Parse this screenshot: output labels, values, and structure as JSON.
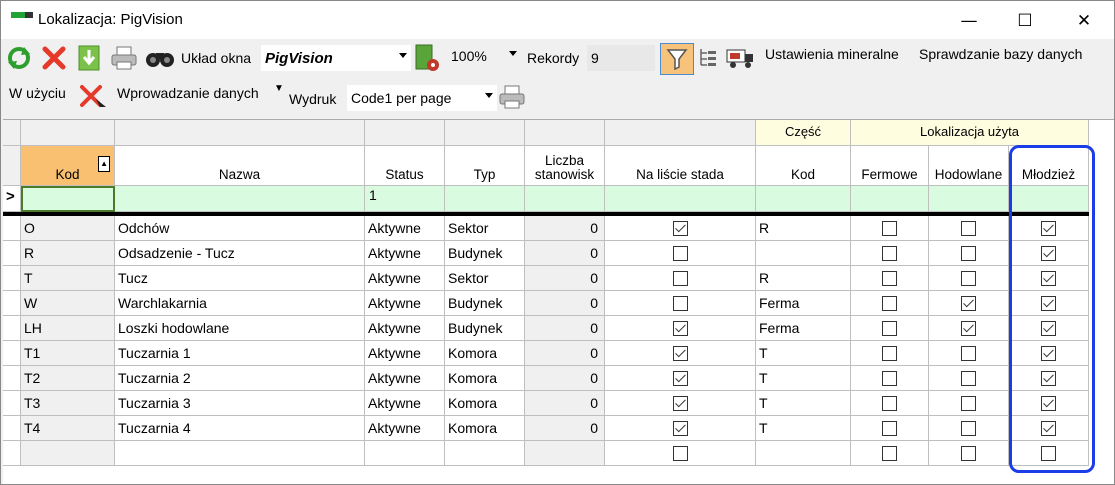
{
  "window": {
    "title": "Lokalizacja: PigVision",
    "min": "—",
    "max": "☐",
    "close": "✕"
  },
  "toolbar": {
    "uklad_label": "Układ okna",
    "uklad_value": "PigVision",
    "zoom": "100%",
    "rekordy_label": "Rekordy",
    "rekordy_value": "9",
    "ustawienia": "Ustawienia mineralne",
    "sprawdzanie": "Sprawdzanie bazy danych",
    "w_uzyciu": "W użyciu",
    "wprowadzanie": "Wprowadzanie danych",
    "wydruk_label": "Wydruk",
    "wydruk_value": "Code1 per page"
  },
  "grid": {
    "group_czesc": "Część",
    "group_lokalizacja": "Lokalizacja użyta",
    "headers": [
      "Kod",
      "Nazwa",
      "Status",
      "Typ",
      "Liczba stanowisk",
      "Na liście stada",
      "Kod",
      "Fermowe",
      "Hodowlane",
      "Młodzież"
    ],
    "new_row_status": "1",
    "rows": [
      {
        "kod": "O",
        "nazwa": "Odchów",
        "status": "Aktywne",
        "typ": "Sektor",
        "liczba": "0",
        "lista": true,
        "czesc": "R",
        "ferm": false,
        "hod": false,
        "mlo": true
      },
      {
        "kod": "R",
        "nazwa": "Odsadzenie - Tucz",
        "status": "Aktywne",
        "typ": "Budynek",
        "liczba": "0",
        "lista": false,
        "czesc": "",
        "ferm": false,
        "hod": false,
        "mlo": true
      },
      {
        "kod": "T",
        "nazwa": "Tucz",
        "status": "Aktywne",
        "typ": "Sektor",
        "liczba": "0",
        "lista": false,
        "czesc": "R",
        "ferm": false,
        "hod": false,
        "mlo": true
      },
      {
        "kod": "W",
        "nazwa": "Warchlakarnia",
        "status": "Aktywne",
        "typ": "Budynek",
        "liczba": "0",
        "lista": false,
        "czesc": "Ferma",
        "ferm": false,
        "hod": true,
        "mlo": true
      },
      {
        "kod": "LH",
        "nazwa": "Loszki hodowlane",
        "status": "Aktywne",
        "typ": "Budynek",
        "liczba": "0",
        "lista": true,
        "czesc": "Ferma",
        "ferm": false,
        "hod": true,
        "mlo": true
      },
      {
        "kod": "T1",
        "nazwa": "Tuczarnia 1",
        "status": "Aktywne",
        "typ": "Komora",
        "liczba": "0",
        "lista": true,
        "czesc": "T",
        "ferm": false,
        "hod": false,
        "mlo": true
      },
      {
        "kod": "T2",
        "nazwa": "Tuczarnia 2",
        "status": "Aktywne",
        "typ": "Komora",
        "liczba": "0",
        "lista": true,
        "czesc": "T",
        "ferm": false,
        "hod": false,
        "mlo": true
      },
      {
        "kod": "T3",
        "nazwa": "Tuczarnia 3",
        "status": "Aktywne",
        "typ": "Komora",
        "liczba": "0",
        "lista": true,
        "czesc": "T",
        "ferm": false,
        "hod": false,
        "mlo": true
      },
      {
        "kod": "T4",
        "nazwa": "Tuczarnia 4",
        "status": "Aktywne",
        "typ": "Komora",
        "liczba": "0",
        "lista": true,
        "czesc": "T",
        "ferm": false,
        "hod": false,
        "mlo": true
      }
    ]
  }
}
